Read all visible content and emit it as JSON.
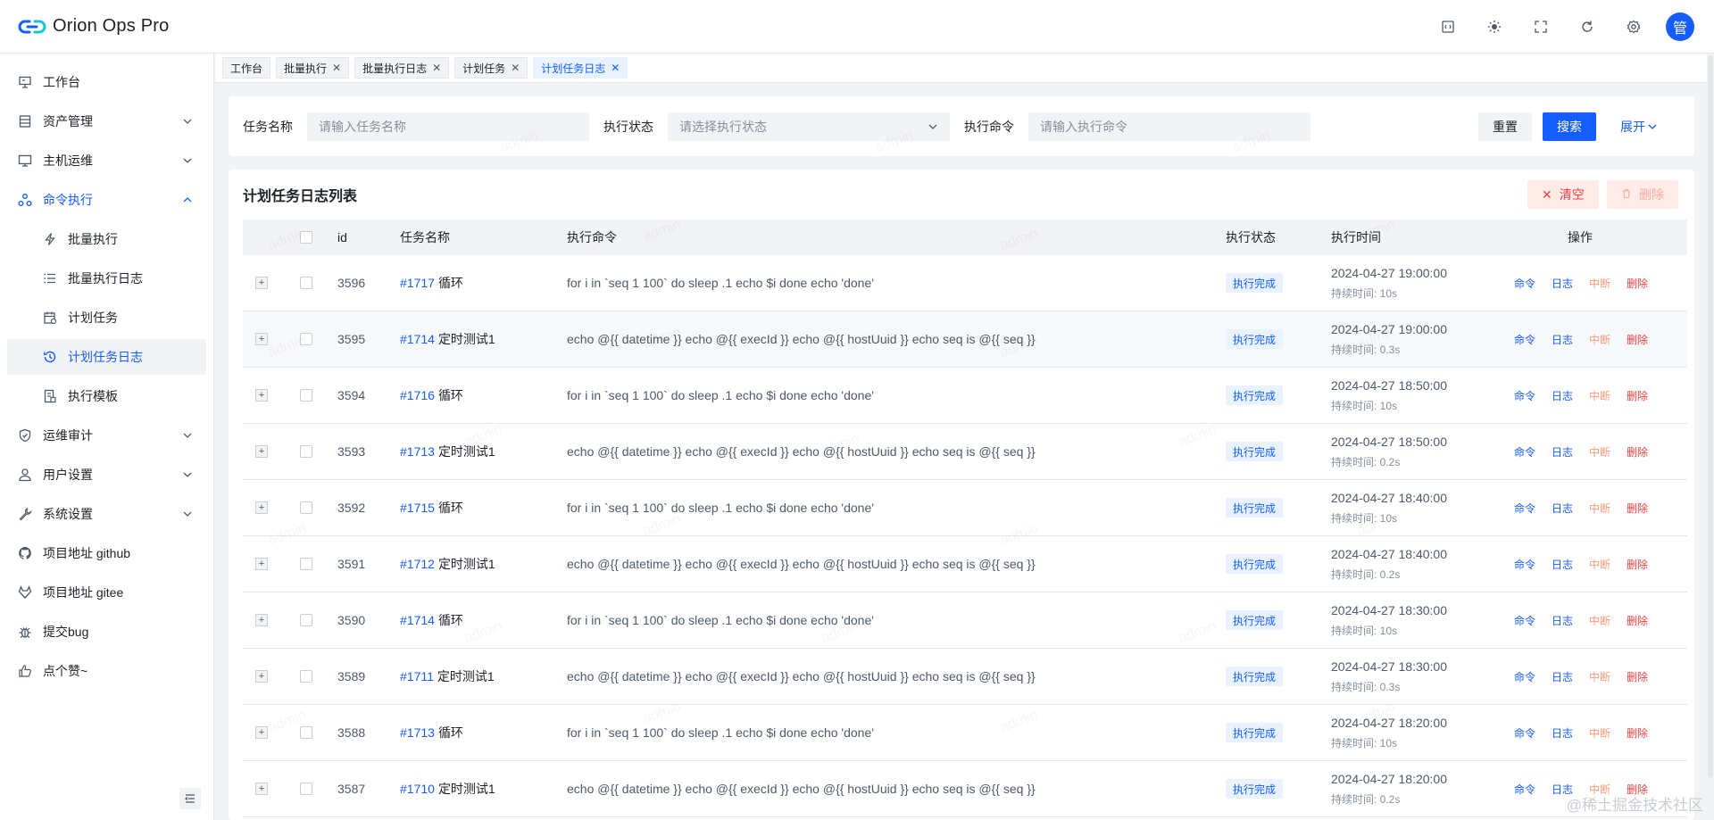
{
  "app": {
    "title": "Orion Ops Pro",
    "avatar_text": "管"
  },
  "header_actions": [
    {
      "name": "api-doc-icon"
    },
    {
      "name": "theme-icon"
    },
    {
      "name": "fullscreen-icon"
    },
    {
      "name": "refresh-icon"
    },
    {
      "name": "settings-icon"
    }
  ],
  "sidebar": {
    "items": [
      {
        "label": "工作台",
        "icon": "workbench-icon",
        "has_children": false
      },
      {
        "label": "资产管理",
        "icon": "asset-icon",
        "has_children": true
      },
      {
        "label": "主机运维",
        "icon": "monitor-icon",
        "has_children": true
      },
      {
        "label": "命令执行",
        "icon": "command-icon",
        "has_children": true,
        "open": true
      },
      {
        "label": "运维审计",
        "icon": "shield-icon",
        "has_children": true
      },
      {
        "label": "用户设置",
        "icon": "user-icon",
        "has_children": true
      },
      {
        "label": "系统设置",
        "icon": "wrench-icon",
        "has_children": true
      },
      {
        "label": "项目地址 github",
        "icon": "github-icon",
        "has_children": false
      },
      {
        "label": "项目地址 gitee",
        "icon": "gitee-icon",
        "has_children": false
      },
      {
        "label": "提交bug",
        "icon": "bug-icon",
        "has_children": false
      },
      {
        "label": "点个赞~",
        "icon": "thumbs-up-icon",
        "has_children": false
      }
    ],
    "sub_items": [
      {
        "label": "批量执行",
        "icon": "lightning-icon"
      },
      {
        "label": "批量执行日志",
        "icon": "list-icon"
      },
      {
        "label": "计划任务",
        "icon": "calendar-icon"
      },
      {
        "label": "计划任务日志",
        "icon": "history-icon",
        "active": true
      },
      {
        "label": "执行模板",
        "icon": "template-icon"
      }
    ]
  },
  "tabs": [
    {
      "label": "工作台",
      "closable": false
    },
    {
      "label": "批量执行",
      "closable": true
    },
    {
      "label": "批量执行日志",
      "closable": true
    },
    {
      "label": "计划任务",
      "closable": true
    },
    {
      "label": "计划任务日志",
      "closable": true,
      "active": true
    }
  ],
  "search": {
    "task_name_label": "任务名称",
    "task_name_placeholder": "请输入任务名称",
    "status_label": "执行状态",
    "status_placeholder": "请选择执行状态",
    "command_label": "执行命令",
    "command_placeholder": "请输入执行命令",
    "reset_label": "重置",
    "search_label": "搜索",
    "expand_label": "展开"
  },
  "table": {
    "title": "计划任务日志列表",
    "clear_label": "清空",
    "delete_label": "删除",
    "columns": {
      "id": "id",
      "task_name": "任务名称",
      "command": "执行命令",
      "status": "执行状态",
      "time": "执行时间",
      "ops": "操作"
    },
    "duration_prefix": "持续时间: ",
    "ops": {
      "command": "命令",
      "log": "日志",
      "interrupt": "中断",
      "delete": "删除"
    },
    "rows": [
      {
        "id": "3596",
        "task_id": "#1717",
        "task_name": "循环",
        "command": "for i in `seq 1 100` do sleep .1 echo $i done echo 'done'",
        "status": "执行完成",
        "time": "2024-04-27 19:00:00",
        "duration": "10s"
      },
      {
        "id": "3595",
        "task_id": "#1714",
        "task_name": "定时测试1",
        "command": "echo @{{ datetime }} echo @{{ execId }} echo @{{ hostUuid }} echo seq is @{{ seq }}",
        "status": "执行完成",
        "time": "2024-04-27 19:00:00",
        "duration": "0.3s"
      },
      {
        "id": "3594",
        "task_id": "#1716",
        "task_name": "循环",
        "command": "for i in `seq 1 100` do sleep .1 echo $i done echo 'done'",
        "status": "执行完成",
        "time": "2024-04-27 18:50:00",
        "duration": "10s"
      },
      {
        "id": "3593",
        "task_id": "#1713",
        "task_name": "定时测试1",
        "command": "echo @{{ datetime }} echo @{{ execId }} echo @{{ hostUuid }} echo seq is @{{ seq }}",
        "status": "执行完成",
        "time": "2024-04-27 18:50:00",
        "duration": "0.2s"
      },
      {
        "id": "3592",
        "task_id": "#1715",
        "task_name": "循环",
        "command": "for i in `seq 1 100` do sleep .1 echo $i done echo 'done'",
        "status": "执行完成",
        "time": "2024-04-27 18:40:00",
        "duration": "10s"
      },
      {
        "id": "3591",
        "task_id": "#1712",
        "task_name": "定时测试1",
        "command": "echo @{{ datetime }} echo @{{ execId }} echo @{{ hostUuid }} echo seq is @{{ seq }}",
        "status": "执行完成",
        "time": "2024-04-27 18:40:00",
        "duration": "0.2s"
      },
      {
        "id": "3590",
        "task_id": "#1714",
        "task_name": "循环",
        "command": "for i in `seq 1 100` do sleep .1 echo $i done echo 'done'",
        "status": "执行完成",
        "time": "2024-04-27 18:30:00",
        "duration": "10s"
      },
      {
        "id": "3589",
        "task_id": "#1711",
        "task_name": "定时测试1",
        "command": "echo @{{ datetime }} echo @{{ execId }} echo @{{ hostUuid }} echo seq is @{{ seq }}",
        "status": "执行完成",
        "time": "2024-04-27 18:30:00",
        "duration": "0.3s"
      },
      {
        "id": "3588",
        "task_id": "#1713",
        "task_name": "循环",
        "command": "for i in `seq 1 100` do sleep .1 echo $i done echo 'done'",
        "status": "执行完成",
        "time": "2024-04-27 18:20:00",
        "duration": "10s"
      },
      {
        "id": "3587",
        "task_id": "#1710",
        "task_name": "定时测试1",
        "command": "echo @{{ datetime }} echo @{{ execId }} echo @{{ hostUuid }} echo seq is @{{ seq }}",
        "status": "执行完成",
        "time": "2024-04-27 18:20:00",
        "duration": "0.2s"
      }
    ]
  },
  "watermark_text": "admin",
  "footer_mark": "@稀土掘金技术社区",
  "colors": {
    "primary": "#165dff",
    "danger": "#f53f3f",
    "tag_bg": "#e8f3ff"
  }
}
